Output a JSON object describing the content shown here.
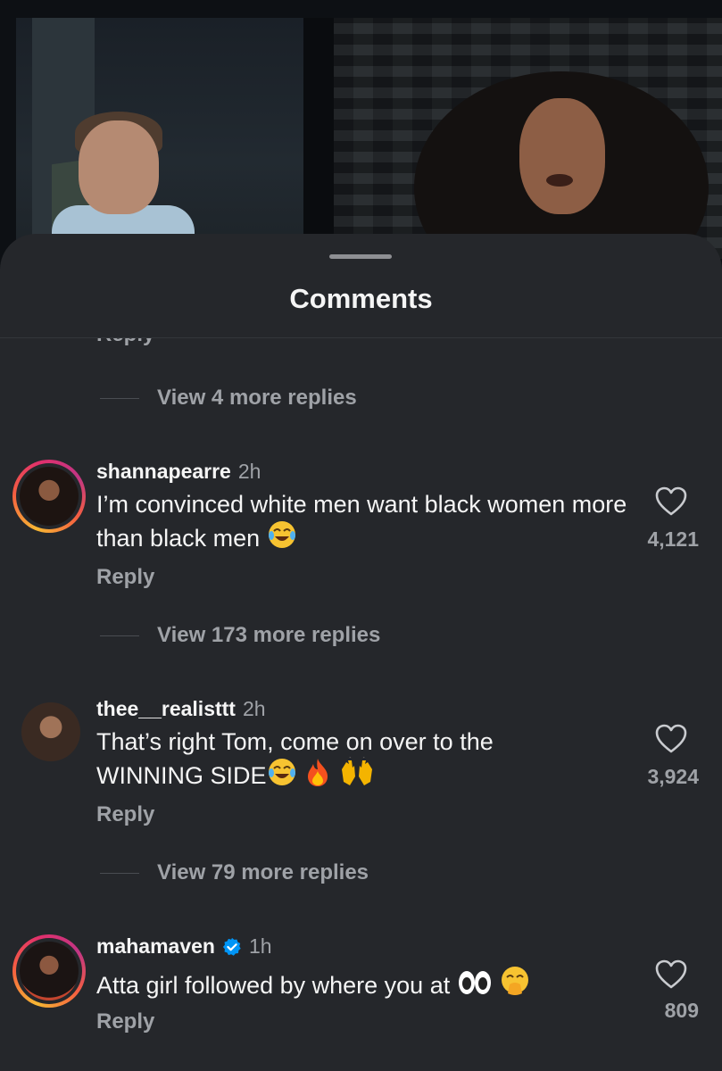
{
  "sheet": {
    "title": "Comments"
  },
  "partial_reply_label": "Reply",
  "view_more": [
    {
      "label": "View 4 more replies"
    },
    {
      "label": "View 173 more replies"
    },
    {
      "label": "View 79 more replies"
    }
  ],
  "comments": [
    {
      "username": "shannapearre",
      "time": "2h",
      "verified": false,
      "has_story_ring": true,
      "text": "I’m convinced white men want black women more than black men",
      "emojis": [
        "face-with-tears-of-joy"
      ],
      "reply_label": "Reply",
      "likes": "4,121"
    },
    {
      "username": "thee__realisttt",
      "time": "2h",
      "verified": false,
      "has_story_ring": false,
      "text": "That’s right Tom, come on over to the WINNING SIDE",
      "emojis": [
        "face-with-tears-of-joy",
        "fire",
        "raising-hands"
      ],
      "reply_label": "Reply",
      "likes": "3,924"
    },
    {
      "username": "mahamaven",
      "time": "1h",
      "verified": true,
      "has_story_ring": true,
      "text": "Atta girl followed by where you at",
      "emojis": [
        "eyes",
        "face-with-hand-over-mouth"
      ],
      "reply_label": "Reply",
      "likes": "809"
    }
  ],
  "colors": {
    "sheet_bg": "#25272b",
    "text_primary": "#f5f5f5",
    "text_secondary": "#9fa2a7",
    "verified_blue": "#0095f6"
  }
}
